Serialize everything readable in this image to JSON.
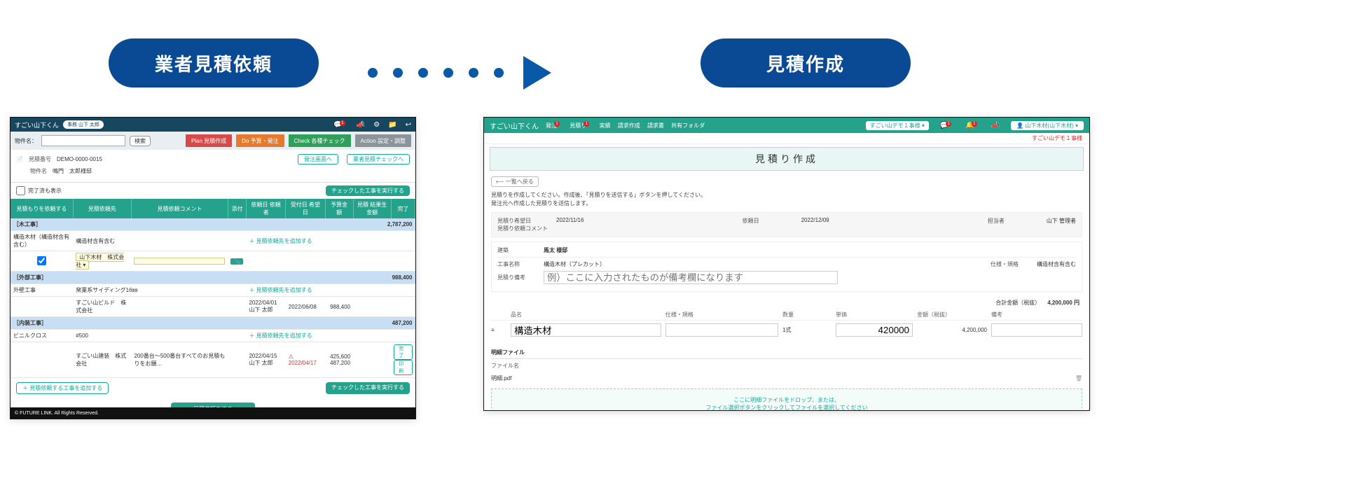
{
  "flow": {
    "left_label": "業者見積依頼",
    "right_label": "見積作成"
  },
  "leftShot": {
    "topbar": {
      "logo": "すごい山下くん",
      "user_chip": "事務 山下 太郎",
      "icons": {
        "chat_badge": "1"
      }
    },
    "search": {
      "label": "物件名：",
      "value": "",
      "button": "検索"
    },
    "tabs": {
      "plan": "Plan 見積作成",
      "do": "Do 予算・発注",
      "check": "Check 各種チェック",
      "action": "Action 設定・調整"
    },
    "meta": {
      "estimate_no_label": "見積番号",
      "estimate_no_value": "DEMO-0000-0015",
      "property_label": "物件名",
      "property_value": "鳴門　太郎様邸",
      "to_order_btn": "発注画面へ",
      "to_check_btn": "業者見積チェックへ"
    },
    "filter": {
      "include_done": "完了済も表示",
      "exec_button": "チェックした工事を実行する"
    },
    "table": {
      "headers": {
        "request": "見積もりを依頼する",
        "vendor": "見積依頼先",
        "comment": "見積依頼コメント",
        "attach": "添付",
        "req_dt": "依頼日\n依頼者",
        "due_dt": "受付日\n希望日",
        "budget": "予算金額",
        "result": "見積\n結果生金額",
        "done": "完了"
      },
      "groups": [
        {
          "title": "［木工事］",
          "group_amount": "2,787,200",
          "rows": [
            {
              "name": "構造木材（構造材含有含む）",
              "note": "構造材含有含む",
              "addlink": "＋ 見積依頼先を追加する"
            }
          ],
          "editor": {
            "vendor_value": "山下木材　株式会社",
            "comment_value": "",
            "attach_icon": "clip-icon"
          }
        },
        {
          "title": "［外部工事］",
          "group_amount": "988,400",
          "rows": [
            {
              "name": "外壁工事",
              "note": "窯業系サイディング16㎜",
              "addlink": "＋ 見積依頼先を追加する"
            }
          ],
          "detail": {
            "vendor": "すごい山ビルド　株式会社",
            "req_date": "2022/04/01\n山下 太郎",
            "due_date": "2022/06/08",
            "budget": "988,400"
          }
        },
        {
          "title": "［内装工事］",
          "group_amount": "487,200",
          "rows": [
            {
              "name": "ビニルクロス",
              "note": "#500",
              "addlink": "＋ 見積依頼先を追加する"
            }
          ],
          "detail": {
            "vendor": "すごい山建装　株式会社",
            "comment": "200番台～500番台すべてのお見積もりをお願…",
            "req_date": "2022/04/15\n山下 太郎",
            "due_date": "2022/04/17",
            "due_date_red": true,
            "budget": "425,600",
            "result": "487,200",
            "done_btn": "完了",
            "print_btn": "印刷"
          }
        }
      ]
    },
    "bottom": {
      "add_work_btn": "＋ 見積依頼する工事を追加する",
      "exec_btn": "チェックした工事を実行する",
      "submit_btn": "見積依頼をする"
    },
    "footer": "© FUTURE LINK. All Rights Reserved."
  },
  "rightShot": {
    "topbar": {
      "logo": "すごい山下くん",
      "nav": {
        "order": "発注",
        "estimate": "見積り",
        "actual": "実績",
        "invoice_c": "請求作成",
        "invoice": "請求書",
        "shared": "共有フォルダ"
      },
      "nav_badges": {
        "order": "1",
        "estimate": "1"
      },
      "demo_label": "すごい山デモ１事様 ▾",
      "icon_badges": {
        "chat": "1",
        "bell": "1"
      },
      "user_btn": "山下木材(山下木材) ▾"
    },
    "substrip": "すごい山デモ１事様",
    "page_title": "見積り作成",
    "back": "⟵ 一覧へ戻る",
    "help": "見積りを作成してください。作成後、「見積りを送信する」ボタンを押してください。\n発注元へ作成した見積りを送信します。",
    "info": {
      "desired_date_lbl": "見積り希望日",
      "desired_date_val": "2022/11/16",
      "req_date_lbl": "依頼日",
      "req_date_val": "2022/12/09",
      "author_lbl": "担当者",
      "author_val": "山下 管理者",
      "comment_lbl": "見積り依頼コメント"
    },
    "property": {
      "heading_lbl": "建築",
      "heading_val": "馬太 様邸",
      "work_lbl": "工事名称",
      "work_val": "構造木材（プレカット）",
      "spec_lbl": "仕様・規格",
      "spec_val": "構造材含有含む",
      "memo_lbl": "見積り備考",
      "memo_ph": "例）ここに入力されたものが備考欄になります"
    },
    "totals": {
      "lbl": "合計金額（税抜）",
      "val": "4,200,000 円"
    },
    "item_head": {
      "idx": "",
      "name": "品名",
      "spec": "仕様・規格",
      "qty": "数量",
      "unit": "単価",
      "amount": "金額（税抜）",
      "note": "備考"
    },
    "item": {
      "idx": "≡",
      "name": "構造木材",
      "spec": "",
      "qty": "1式",
      "unit": "420000",
      "amount": "4,200,000",
      "note": ""
    },
    "files": {
      "section": "明細ファイル",
      "col": "ファイル名",
      "name": "明細.pdf",
      "drop1": "ここに明細ファイルをドロップ、または、",
      "drop2": "ファイル選択ボタンをクリックしてファイルを選択してください"
    }
  }
}
